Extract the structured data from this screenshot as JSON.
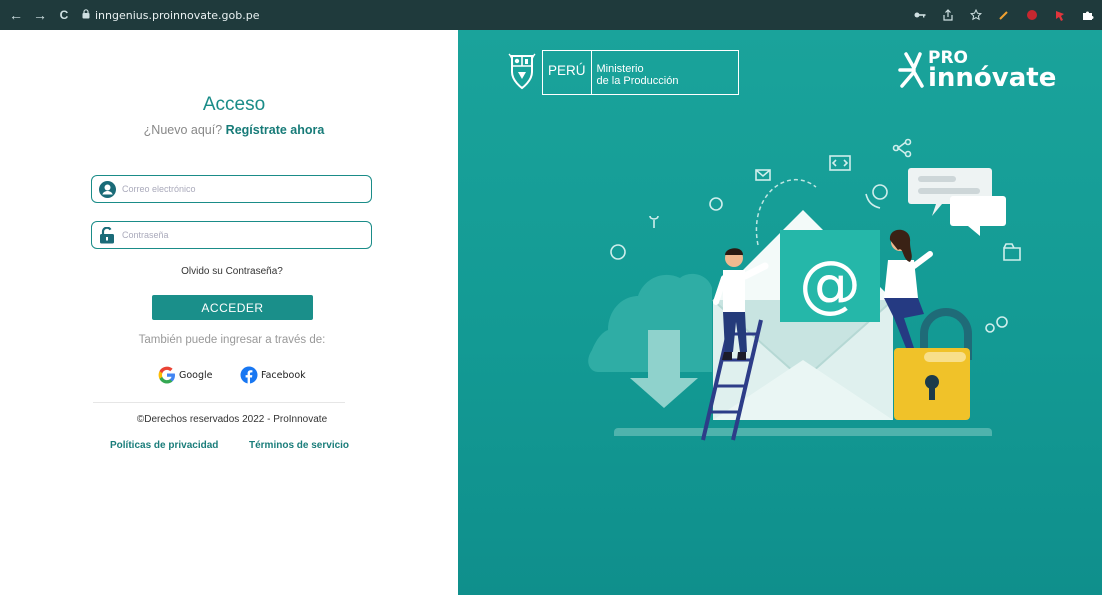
{
  "browser": {
    "url": "inngenius.proinnovate.gob.pe",
    "back_icon": "←",
    "forward_icon": "→",
    "reload_icon": "C"
  },
  "login": {
    "title": "Acceso",
    "new_here": "¿Nuevo aquí?",
    "register_link": "Regístrate ahora",
    "email_placeholder": "Correo electrónico",
    "password_placeholder": "Contraseña",
    "forgot_password": "Olvido su Contraseña?",
    "submit_label": "ACCEDER",
    "alt_login_text": "También puede ingresar a través de:",
    "google_label": "Google",
    "facebook_label": "Facebook",
    "copyright": "©Derechos reservados 2022 - ProInnovate",
    "privacy_link": "Políticas de privacidad",
    "terms_link": "Términos de servicio"
  },
  "branding": {
    "country": "PERÚ",
    "ministry_line1": "Ministerio",
    "ministry_line2": "de la Producción",
    "pro_line1": "PRO",
    "pro_line2": "innóvate",
    "email_symbol": "@"
  },
  "colors": {
    "accent": "#1a8f8a",
    "panel_bg": "#139a94",
    "browser_bar": "#1f3a3c"
  }
}
